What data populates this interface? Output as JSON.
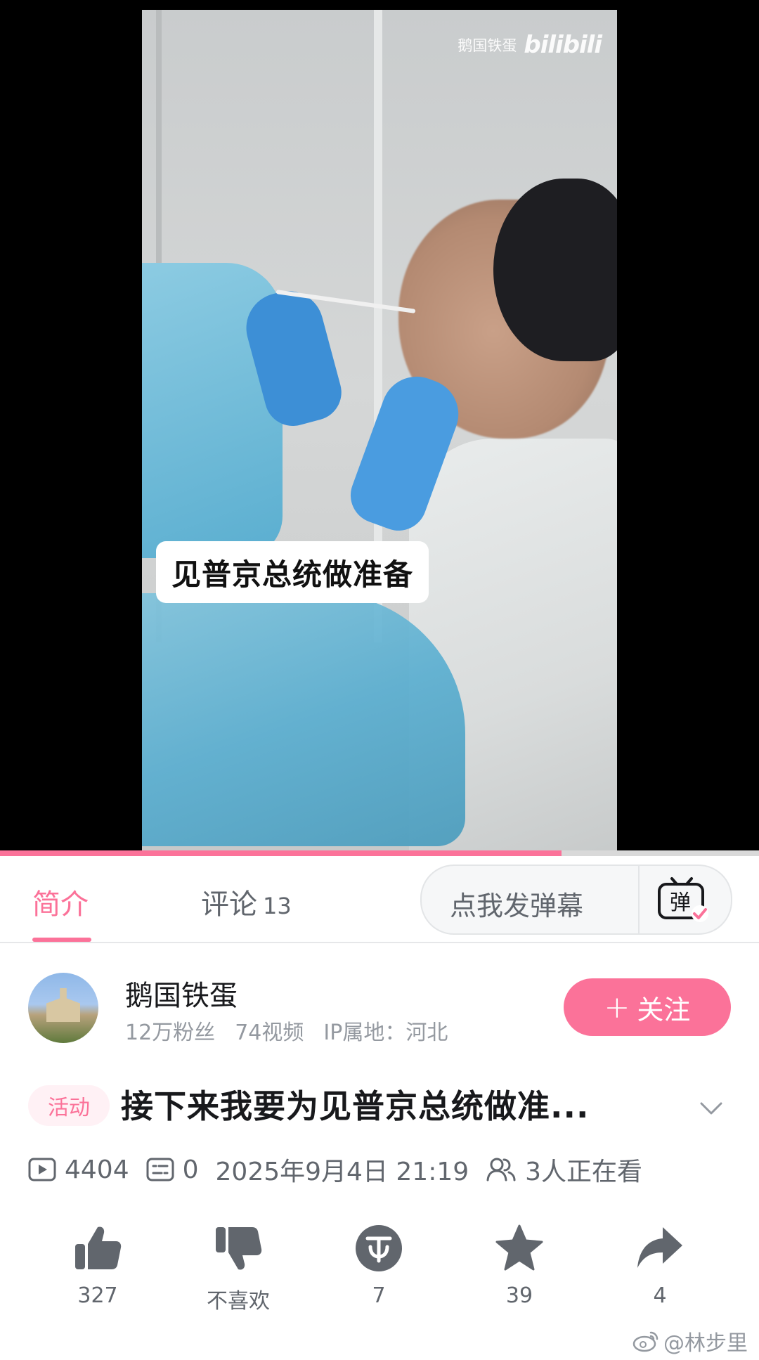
{
  "video": {
    "watermark_name": "鹅国铁蛋",
    "watermark_brand": "bilibili",
    "caption": "见普京总统做准备",
    "progress_fraction": 0.74
  },
  "tabs": {
    "intro_label": "简介",
    "comments_label": "评论",
    "comments_count": "13",
    "danmaku_placeholder": "点我发弹幕",
    "danmaku_icon_glyph": "弹"
  },
  "uploader": {
    "name": "鹅国铁蛋",
    "fans": "12万粉丝",
    "videos": "74视频",
    "ip": "IP属地：河北",
    "follow_label": "关注",
    "follow_plus": "+"
  },
  "title": {
    "tag": "活动",
    "text": "接下来我要为见普京总统做准..."
  },
  "stats": {
    "plays": "4404",
    "danmaku": "0",
    "datetime": "2025年9月4日 21:19",
    "watching": "3人正在看"
  },
  "actions": {
    "like": "327",
    "dislike": "不喜欢",
    "coin": "7",
    "favorite": "39",
    "share": "4"
  },
  "weibo": {
    "handle": "@林步里"
  },
  "colors": {
    "accent": "#fb7299",
    "icon_gray": "#61666d"
  }
}
